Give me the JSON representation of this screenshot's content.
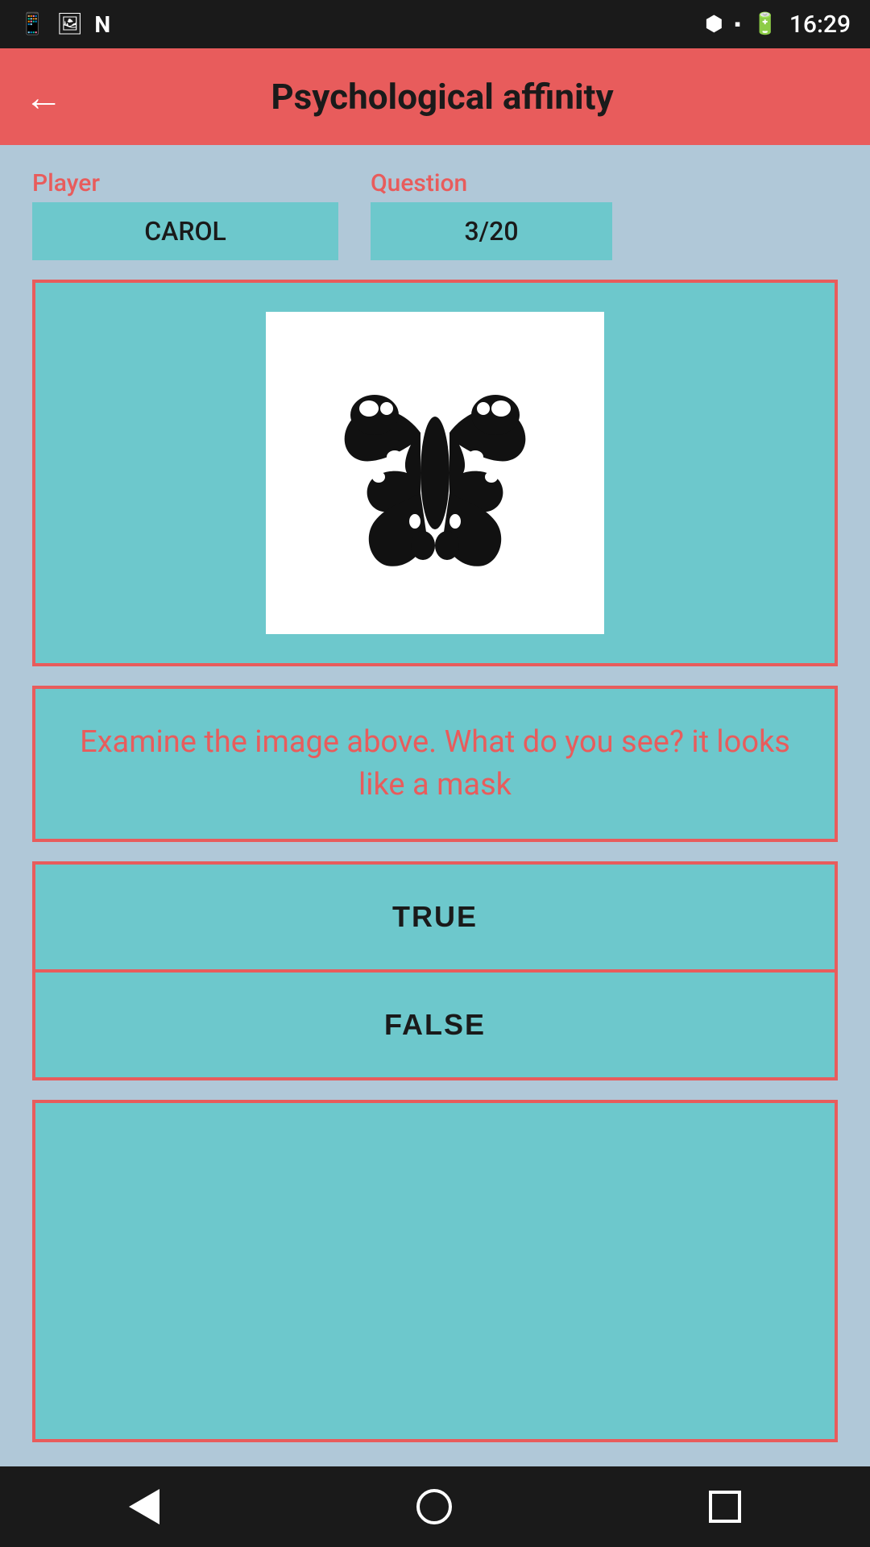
{
  "statusBar": {
    "time": "16:29",
    "icons": [
      "phone-icon",
      "image-icon",
      "n-icon",
      "bluetooth-icon",
      "sim-icon",
      "battery-icon"
    ]
  },
  "header": {
    "title": "Psychological affinity",
    "backLabel": "←"
  },
  "playerField": {
    "label": "Player",
    "value": "CAROL"
  },
  "questionField": {
    "label": "Question",
    "value": "3/20"
  },
  "questionText": "Examine the image above. What do you see? it looks like a mask",
  "answers": [
    {
      "label": "TRUE"
    },
    {
      "label": "FALSE"
    }
  ],
  "navBar": {
    "back": "back-icon",
    "home": "home-icon",
    "recents": "recents-icon"
  }
}
